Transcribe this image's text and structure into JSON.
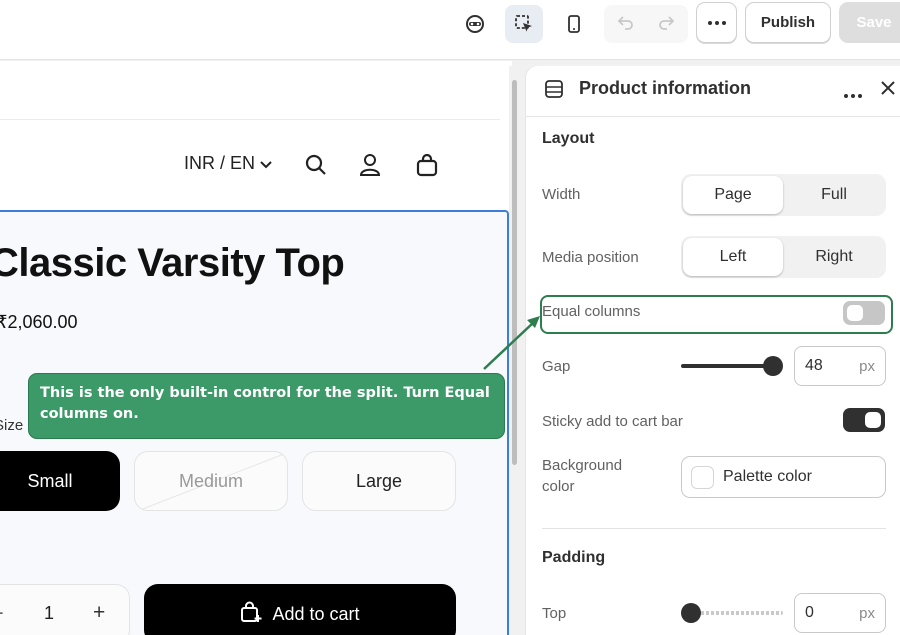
{
  "topbar": {
    "icons": [
      "inspector-icon",
      "select-icon",
      "mobile-icon",
      "undo-icon",
      "redo-icon",
      "more-icon"
    ],
    "publish_label": "Publish",
    "save_label": "Save"
  },
  "preview": {
    "locale": "INR / EN",
    "product_title": "Classic Varsity Top",
    "price": "₹2,060.00",
    "size_label": "Size",
    "sizes": [
      "Small",
      "Medium",
      "Large"
    ],
    "selected_size": "Small",
    "unavailable_size": "Medium",
    "quantity": "1",
    "qty_minus": "−",
    "qty_plus": "+",
    "add_to_cart": "Add to cart"
  },
  "panel": {
    "title": "Product information",
    "layout_heading": "Layout",
    "width_label": "Width",
    "width_options": [
      "Page",
      "Full"
    ],
    "width_selected": "Page",
    "media_label": "Media position",
    "media_options": [
      "Left",
      "Right"
    ],
    "media_selected": "Left",
    "equal_columns_label": "Equal columns",
    "equal_columns_on": false,
    "gap_label": "Gap",
    "gap_value": "48",
    "gap_unit": "px",
    "gap_fraction": 1.0,
    "sticky_label": "Sticky add to cart bar",
    "sticky_on": true,
    "bg_label_line1": "Background",
    "bg_label_line2": "color",
    "bg_value": "Palette color",
    "padding_heading": "Padding",
    "top_label": "Top",
    "top_value": "0",
    "top_unit": "px",
    "top_fraction": 0.0
  },
  "callout": {
    "text": "This is the only built-in control for the split. Turn Equal columns on."
  },
  "colors": {
    "callout_bg": "#3b9a67",
    "highlight_border": "#2e7d4f",
    "selection_border": "#3d7fd6",
    "toggle_on": "#303030",
    "toggle_off": "#c6c6c6"
  }
}
